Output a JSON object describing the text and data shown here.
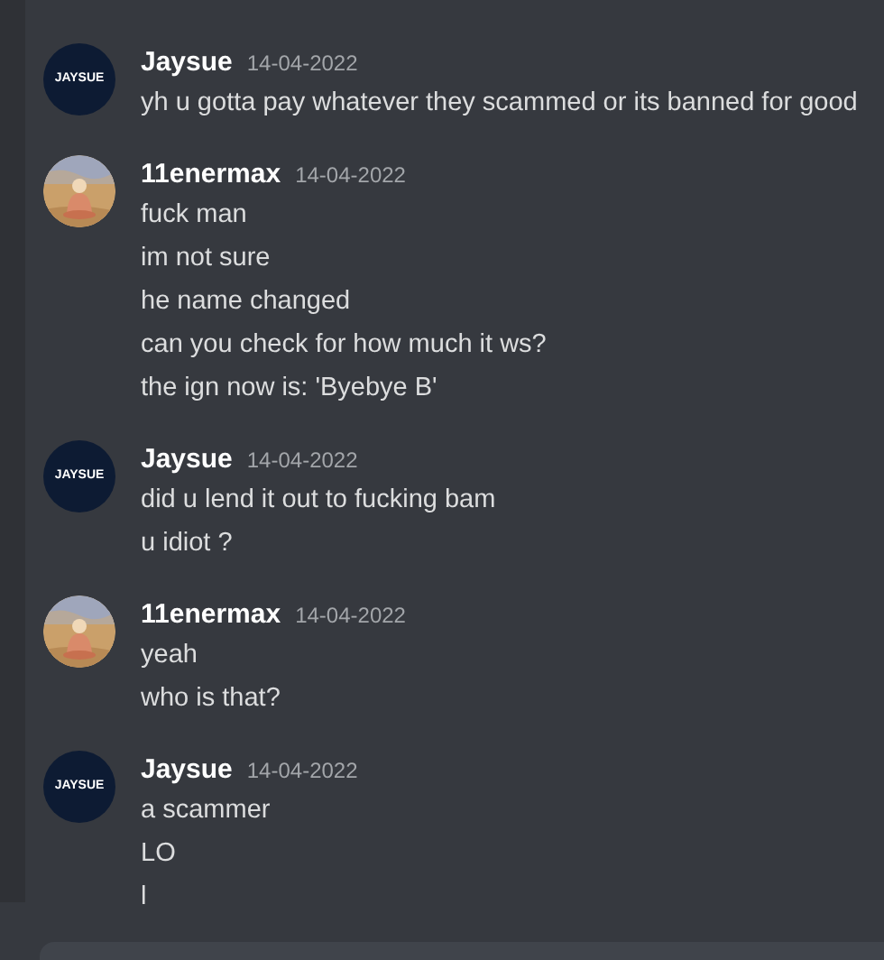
{
  "messages": [
    {
      "author": "Jaysue",
      "avatar": {
        "kind": "text",
        "label": "JAYSUE"
      },
      "timestamp": "14-04-2022",
      "lines": [
        "yh u gotta pay whatever they scammed or its banned for good"
      ]
    },
    {
      "author": "11enermax",
      "avatar": {
        "kind": "picture"
      },
      "timestamp": "14-04-2022",
      "lines": [
        "fuck man",
        "im not sure",
        "he name changed",
        "can you check for how much it ws?",
        "the ign now is: 'Byebye B'"
      ]
    },
    {
      "author": "Jaysue",
      "avatar": {
        "kind": "text",
        "label": "JAYSUE"
      },
      "timestamp": "14-04-2022",
      "lines": [
        "did u lend it out to fucking bam",
        "u idiot ?"
      ]
    },
    {
      "author": "11enermax",
      "avatar": {
        "kind": "picture"
      },
      "timestamp": "14-04-2022",
      "lines": [
        "yeah",
        "who is that?"
      ]
    },
    {
      "author": "Jaysue",
      "avatar": {
        "kind": "text",
        "label": "JAYSUE"
      },
      "timestamp": "14-04-2022",
      "lines": [
        "a scammer",
        "LO",
        "l"
      ]
    }
  ]
}
